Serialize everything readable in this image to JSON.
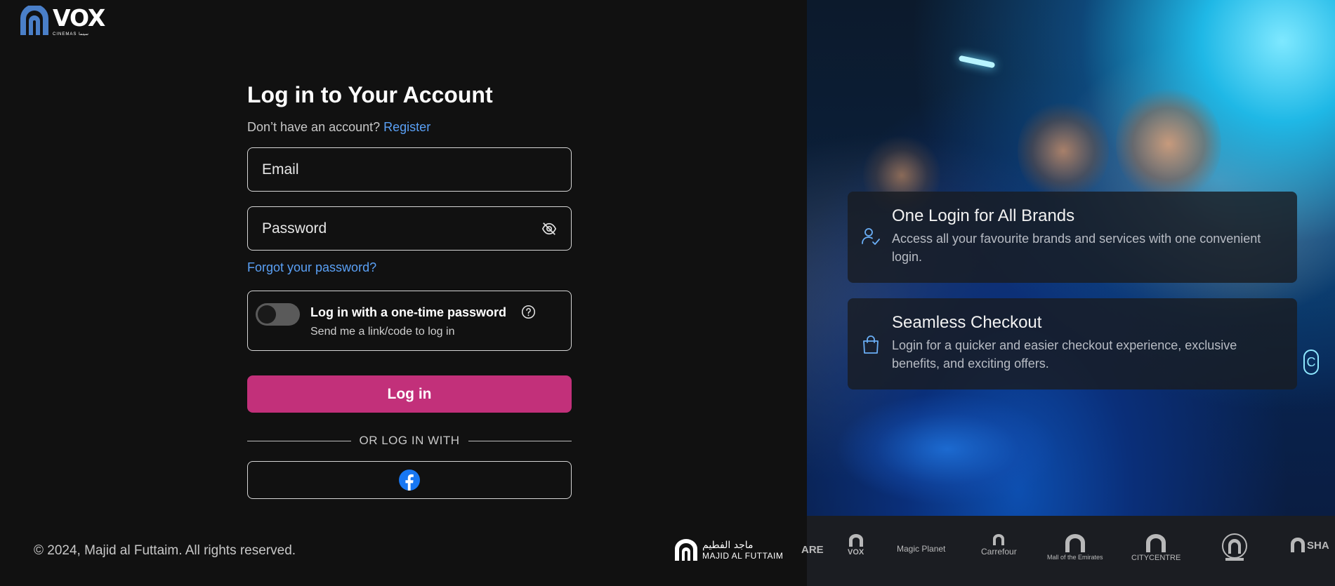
{
  "brand": {
    "name": "VOX",
    "tagline": "CINEMAS سينما"
  },
  "form": {
    "title": "Log in to Your Account",
    "no_account_text": "Don’t have an account?",
    "register_link": "Register",
    "email_placeholder": "Email",
    "password_placeholder": "Password",
    "forgot_link": "Forgot your password?",
    "otp": {
      "title": "Log in with a one-time password",
      "subtitle": "Send me a link/code to log in",
      "enabled": false
    },
    "login_button": "Log in",
    "divider_text": "OR LOG IN WITH",
    "social": [
      "facebook-icon"
    ]
  },
  "footer": {
    "copyright": "© 2024, Majid al Futtaim. All rights reserved.",
    "parent_logo_ar": "ماجد الفطيم",
    "parent_logo_en": "MAJID AL FUTTAIM"
  },
  "features": [
    {
      "icon": "user-check-icon",
      "title": "One Login for All Brands",
      "text": "Access all your favourite brands and services with one convenient login."
    },
    {
      "icon": "shopping-bag-icon",
      "title": "Seamless Checkout",
      "text": "Login for a quicker and easier checkout experience, exclusive benefits, and exciting offers."
    }
  ],
  "brands_strip": [
    "ARE",
    "VOX",
    "Magic Planet",
    "Carrefour",
    "Mall of the Emirates",
    "CITYCENTRE",
    "",
    "SHA"
  ],
  "colors": {
    "accent_link": "#5aa0f5",
    "primary_button": "#c2307a",
    "background": "#111111",
    "facebook": "#1877f2",
    "feature_icon": "#6aaef5"
  }
}
